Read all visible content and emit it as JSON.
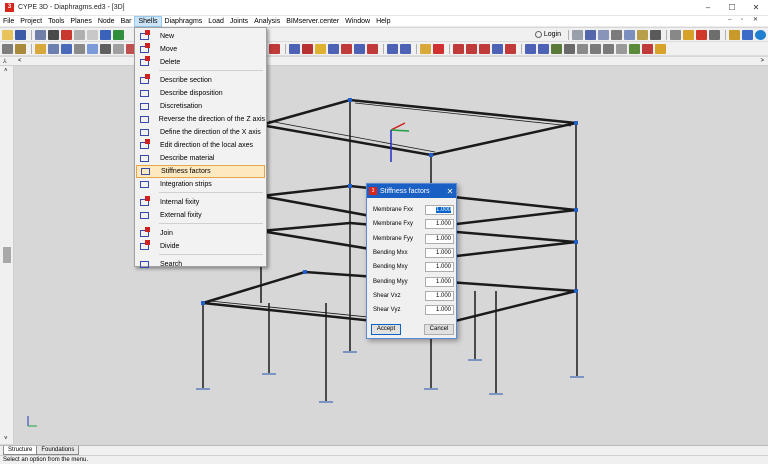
{
  "window": {
    "title": "CYPE 3D - Diaphragms.ed3 - [3D]",
    "minimize": "–",
    "maximize": "☐",
    "close": "✕"
  },
  "menubar": {
    "items": [
      "File",
      "Project",
      "Tools",
      "Planes",
      "Node",
      "Bar",
      "Shells",
      "Diaphragms",
      "Load",
      "Joints",
      "Analysis",
      "BIMserver.center",
      "Window",
      "Help"
    ],
    "active": "Shells",
    "mdi_controls": "– ▫ ✕"
  },
  "toolbar": {
    "login_label": "Login"
  },
  "viewport_nav": {
    "left_arrow": "<",
    "right_arrow": ">",
    "up_arrow": "˄",
    "down_arrow": "˅",
    "axis_glyph": "⅄"
  },
  "shells_menu": {
    "items": [
      {
        "label": "New",
        "icon": "new-shell-icon"
      },
      {
        "label": "Move",
        "icon": "move-shell-icon"
      },
      {
        "label": "Delete",
        "icon": "delete-shell-icon"
      },
      {
        "label": "Describe section",
        "icon": "describe-section-icon"
      },
      {
        "label": "Describe disposition",
        "icon": "describe-disposition-icon"
      },
      {
        "label": "Discretisation",
        "icon": "discretisation-icon"
      },
      {
        "label": "Reverse the direction of the Z axis",
        "icon": "reverse-z-axis-icon"
      },
      {
        "label": "Define the direction of the X axis",
        "icon": "define-x-axis-icon"
      },
      {
        "label": "Edit direction of the local axes",
        "icon": "local-axes-icon"
      },
      {
        "label": "Describe material",
        "icon": "describe-material-icon"
      },
      {
        "label": "Stiffness factors",
        "icon": "stiffness-factors-icon"
      },
      {
        "label": "Integration strips",
        "icon": "integration-strips-icon"
      },
      {
        "label": "Internal fixity",
        "icon": "internal-fixity-icon"
      },
      {
        "label": "External fixity",
        "icon": "external-fixity-icon"
      },
      {
        "label": "Join",
        "icon": "join-icon"
      },
      {
        "label": "Divide",
        "icon": "divide-icon"
      },
      {
        "label": "Search",
        "icon": "search-icon"
      }
    ],
    "highlighted": "Stiffness factors"
  },
  "stiffness_dialog": {
    "title": "Stiffness factors",
    "close": "✕",
    "fields": [
      {
        "label": "Membrane Fxx",
        "value": "1.000"
      },
      {
        "label": "Membrane Fxy",
        "value": "1.000"
      },
      {
        "label": "Membrane Fyy",
        "value": "1.000"
      },
      {
        "label": "Bending Mxx",
        "value": "1.000"
      },
      {
        "label": "Bending Mxy",
        "value": "1.000"
      },
      {
        "label": "Bending Myy",
        "value": "1.000"
      },
      {
        "label": "Shear Vxz",
        "value": "1.000"
      },
      {
        "label": "Shear Vyz",
        "value": "1.000"
      }
    ],
    "accept_label": "Accept",
    "cancel_label": "Cancel"
  },
  "tabs": [
    "Structure",
    "Foundations"
  ],
  "status_text": "Select an option from the menu.",
  "colors": {
    "accent": "#1a5fc4",
    "menu_highlight": "#fde8c0",
    "viewport_bg": "#d7d7d7",
    "node": "#2060c8"
  }
}
